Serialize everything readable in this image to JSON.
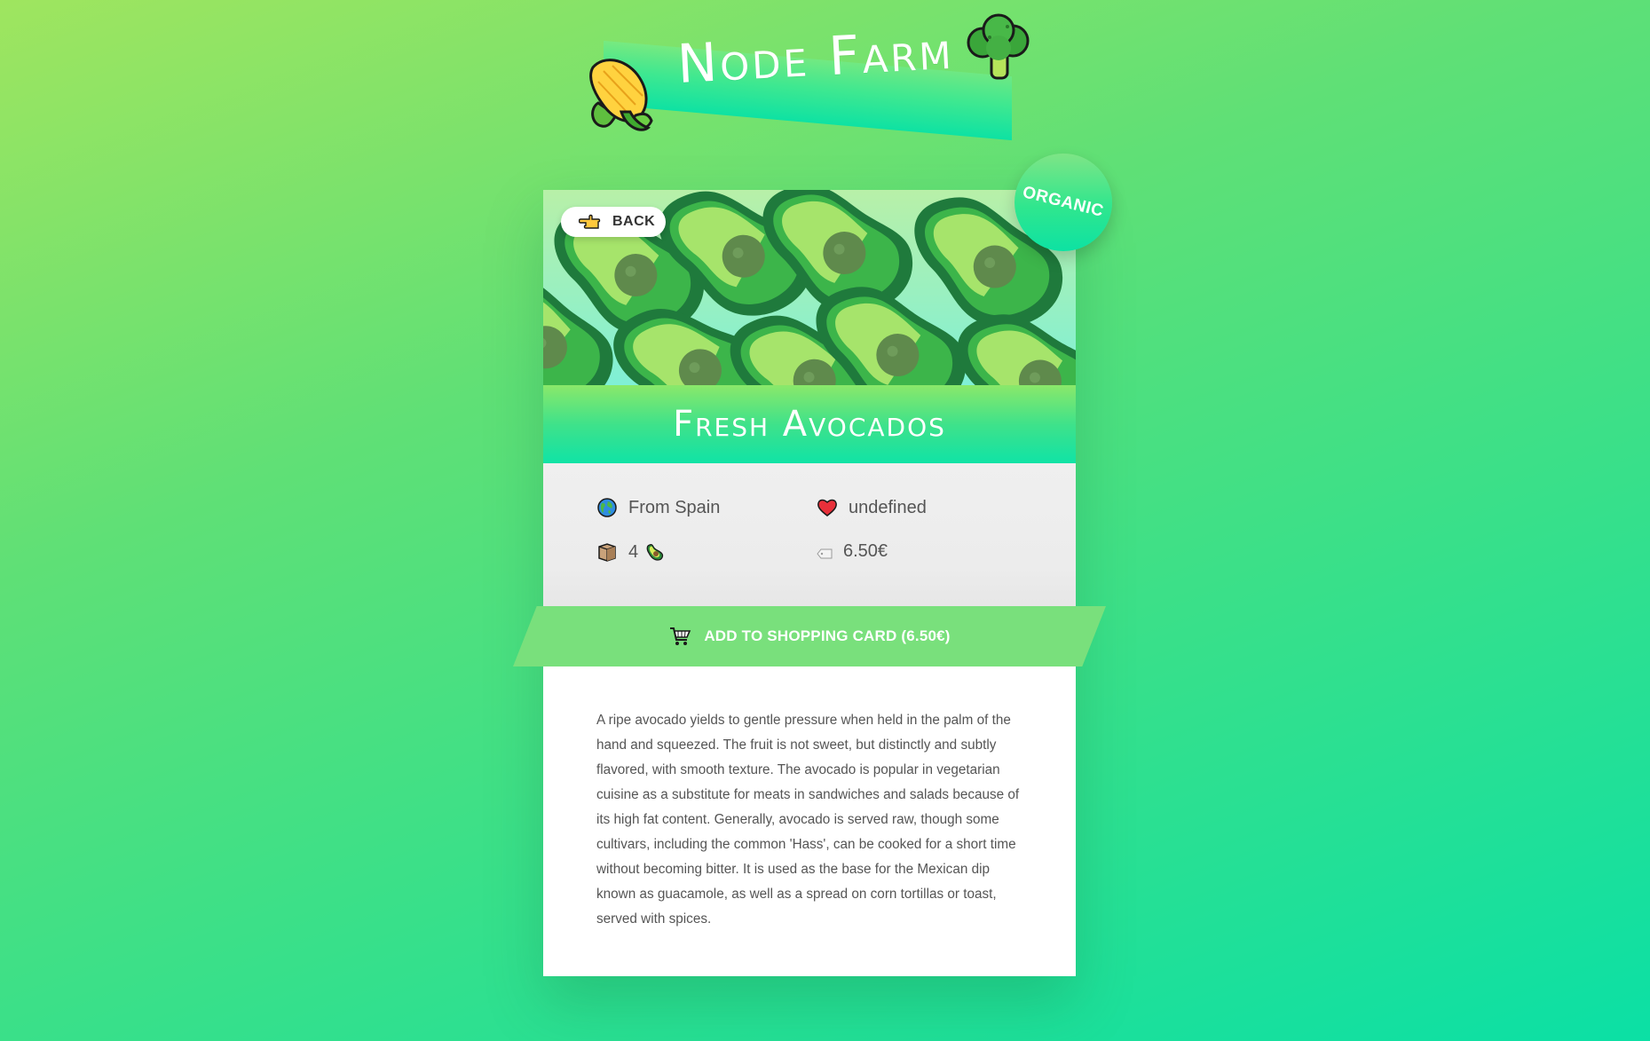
{
  "header": {
    "title": "Node Farm",
    "left_icon": "corn-icon",
    "right_icon": "broccoli-icon"
  },
  "product": {
    "back_label": "BACK",
    "badge": "ORGANIC",
    "title": "Fresh Avocados",
    "origin": "From Spain",
    "nutrients": "undefined",
    "quantity": "4",
    "price": "6.50€",
    "cart_label": "ADD TO SHOPPING CARD (6.50€)",
    "description": "A ripe avocado yields to gentle pressure when held in the palm of the hand and squeezed. The fruit is not sweet, but distinctly and subtly flavored, with smooth texture. The avocado is popular in vegetarian cuisine as a substitute for meats in sandwiches and salads because of its high fat content. Generally, avocado is served raw, though some cultivars, including the common 'Hass', can be cooked for a short time without becoming bitter. It is used as the base for the Mexican dip known as guacamole, as well as a spread on corn tortillas or toast, served with spices."
  },
  "icons": {
    "origin": "globe-icon",
    "nutrients": "heart-icon",
    "quantity": "box-icon",
    "quantity_unit": "avocado-icon",
    "price": "price-tag-icon",
    "cart": "shopping-cart-icon",
    "back": "pointing-hand-icon"
  },
  "colors": {
    "accent": "#79e07c",
    "title_gradient_end": "#10e3a6",
    "text": "#555555"
  }
}
